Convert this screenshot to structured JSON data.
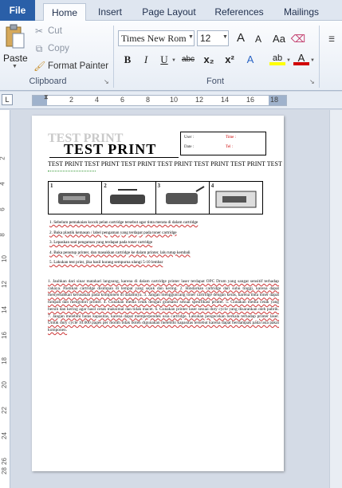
{
  "tabs": [
    "File",
    "Home",
    "Insert",
    "Page Layout",
    "References",
    "Mailings"
  ],
  "clipboard": {
    "paste": "Paste",
    "cut": "Cut",
    "copy": "Copy",
    "format_painter": "Format Painter",
    "group_label": "Clipboard"
  },
  "font": {
    "name": "Times New Rom",
    "size": "12",
    "group_label": "Font",
    "bold": "B",
    "italic": "I",
    "underline": "U",
    "strike": "abc",
    "subscript": "x₂",
    "superscript": "x²",
    "grow": "A",
    "shrink": "A",
    "highlight": "ab",
    "color": "A"
  },
  "ruler": {
    "tab_selector": "L",
    "h_numbers": [
      "2",
      "4",
      "6",
      "8",
      "10",
      "12",
      "14",
      "16",
      "18"
    ],
    "v_numbers": [
      "2",
      "4",
      "6",
      "8",
      "10",
      "12",
      "14",
      "16",
      "18",
      "20",
      "22",
      "24",
      "26",
      "28"
    ]
  },
  "document": {
    "shadow_title": "TEST PRINT",
    "title": "TEST PRINT",
    "info_user": "User :",
    "info_date": "Date :",
    "info_time": "Time :",
    "info_tel": "Tel :",
    "heading_line": "TEST PRINT TEST PRINT TEST PRINT TEST PRINT TEST PRINT TEST PRINT TEST PRINT",
    "diagram_steps": [
      "1",
      "2",
      "3",
      "4"
    ],
    "steps": [
      "1.  Sebelum pemakaian kocok pelan cartridge tersebut agar tinta merata di dalam cartridge",
      "2.  Buka plastik kemasan / label pengaman yang terdapat pada toner cartridge",
      "3.  Lepaskan seal pengaman yang terdapat pada toner cartridge",
      "4.  Buka penutup printer, dan masukkan cartridge ke dalam printer, lalu tutup kembali",
      "5.  Lakukan test print, jika hasil kurang sempurna ulangi 5-10 lembar"
    ],
    "paragraph": "1. Jauhkan dari sinar matahari langsung, karena di dalam cartridge printer laser terdapat OPC Drum yang sangat sensitif terhadap cahaya. Pastikan cartridge disimpan di tempat yang sejuk dan kering. 2. Hindarkan cartridge dari suhu tinggi, karena dapat menyebabkan kerusakan pada komponen di dalamnya. 3. Jangan mengguncang toner cartridge dengan keras, karena tinta toner dapat tumpah dan mengotori printer. 4. Gunakan media cetak dengan gramatur sesuai spesifikasi printer. 5. Gunakan media cetak yang bersih dan kering agar hasil cetak maksimal dan tidak macet. 6. Gunakan printer laser sesuai duty cycle yang disarankan oleh pabrik. 7. Jangan melebihi batas kapasitas, karena dapat memperpendek usia cartridge. Lakukan pengecekan berkala terhadap printer laser. Untuk duty cycle 10.000 pages per month tidak boleh digunakan melebihi kapasitas tersebut karena dapat berdampak pada usia pakai komponen."
  }
}
